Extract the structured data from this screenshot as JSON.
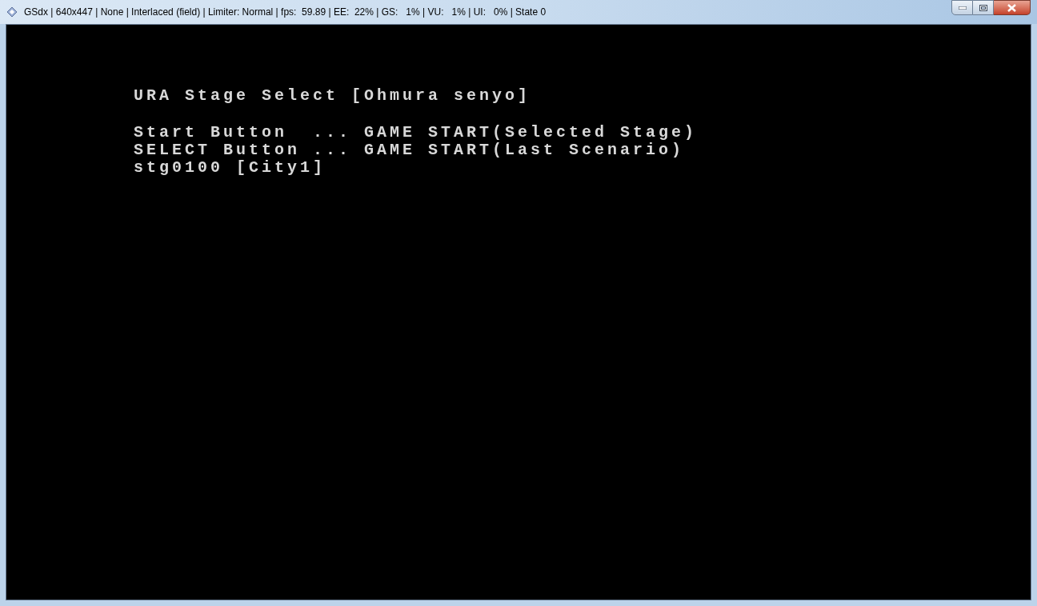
{
  "window": {
    "title": "GSdx | 640x447 | None | Interlaced (field) | Limiter: Normal | fps:  59.89 | EE:  22% | GS:   1% | VU:   1% | UI:   0% | State 0"
  },
  "screen": {
    "heading": "URA Stage Select [Ohmura senyo]",
    "lines": [
      "Start Button  ... GAME START(Selected Stage)",
      "SELECT Button ... GAME START(Last Scenario)",
      "stg0100 [City1]"
    ]
  }
}
